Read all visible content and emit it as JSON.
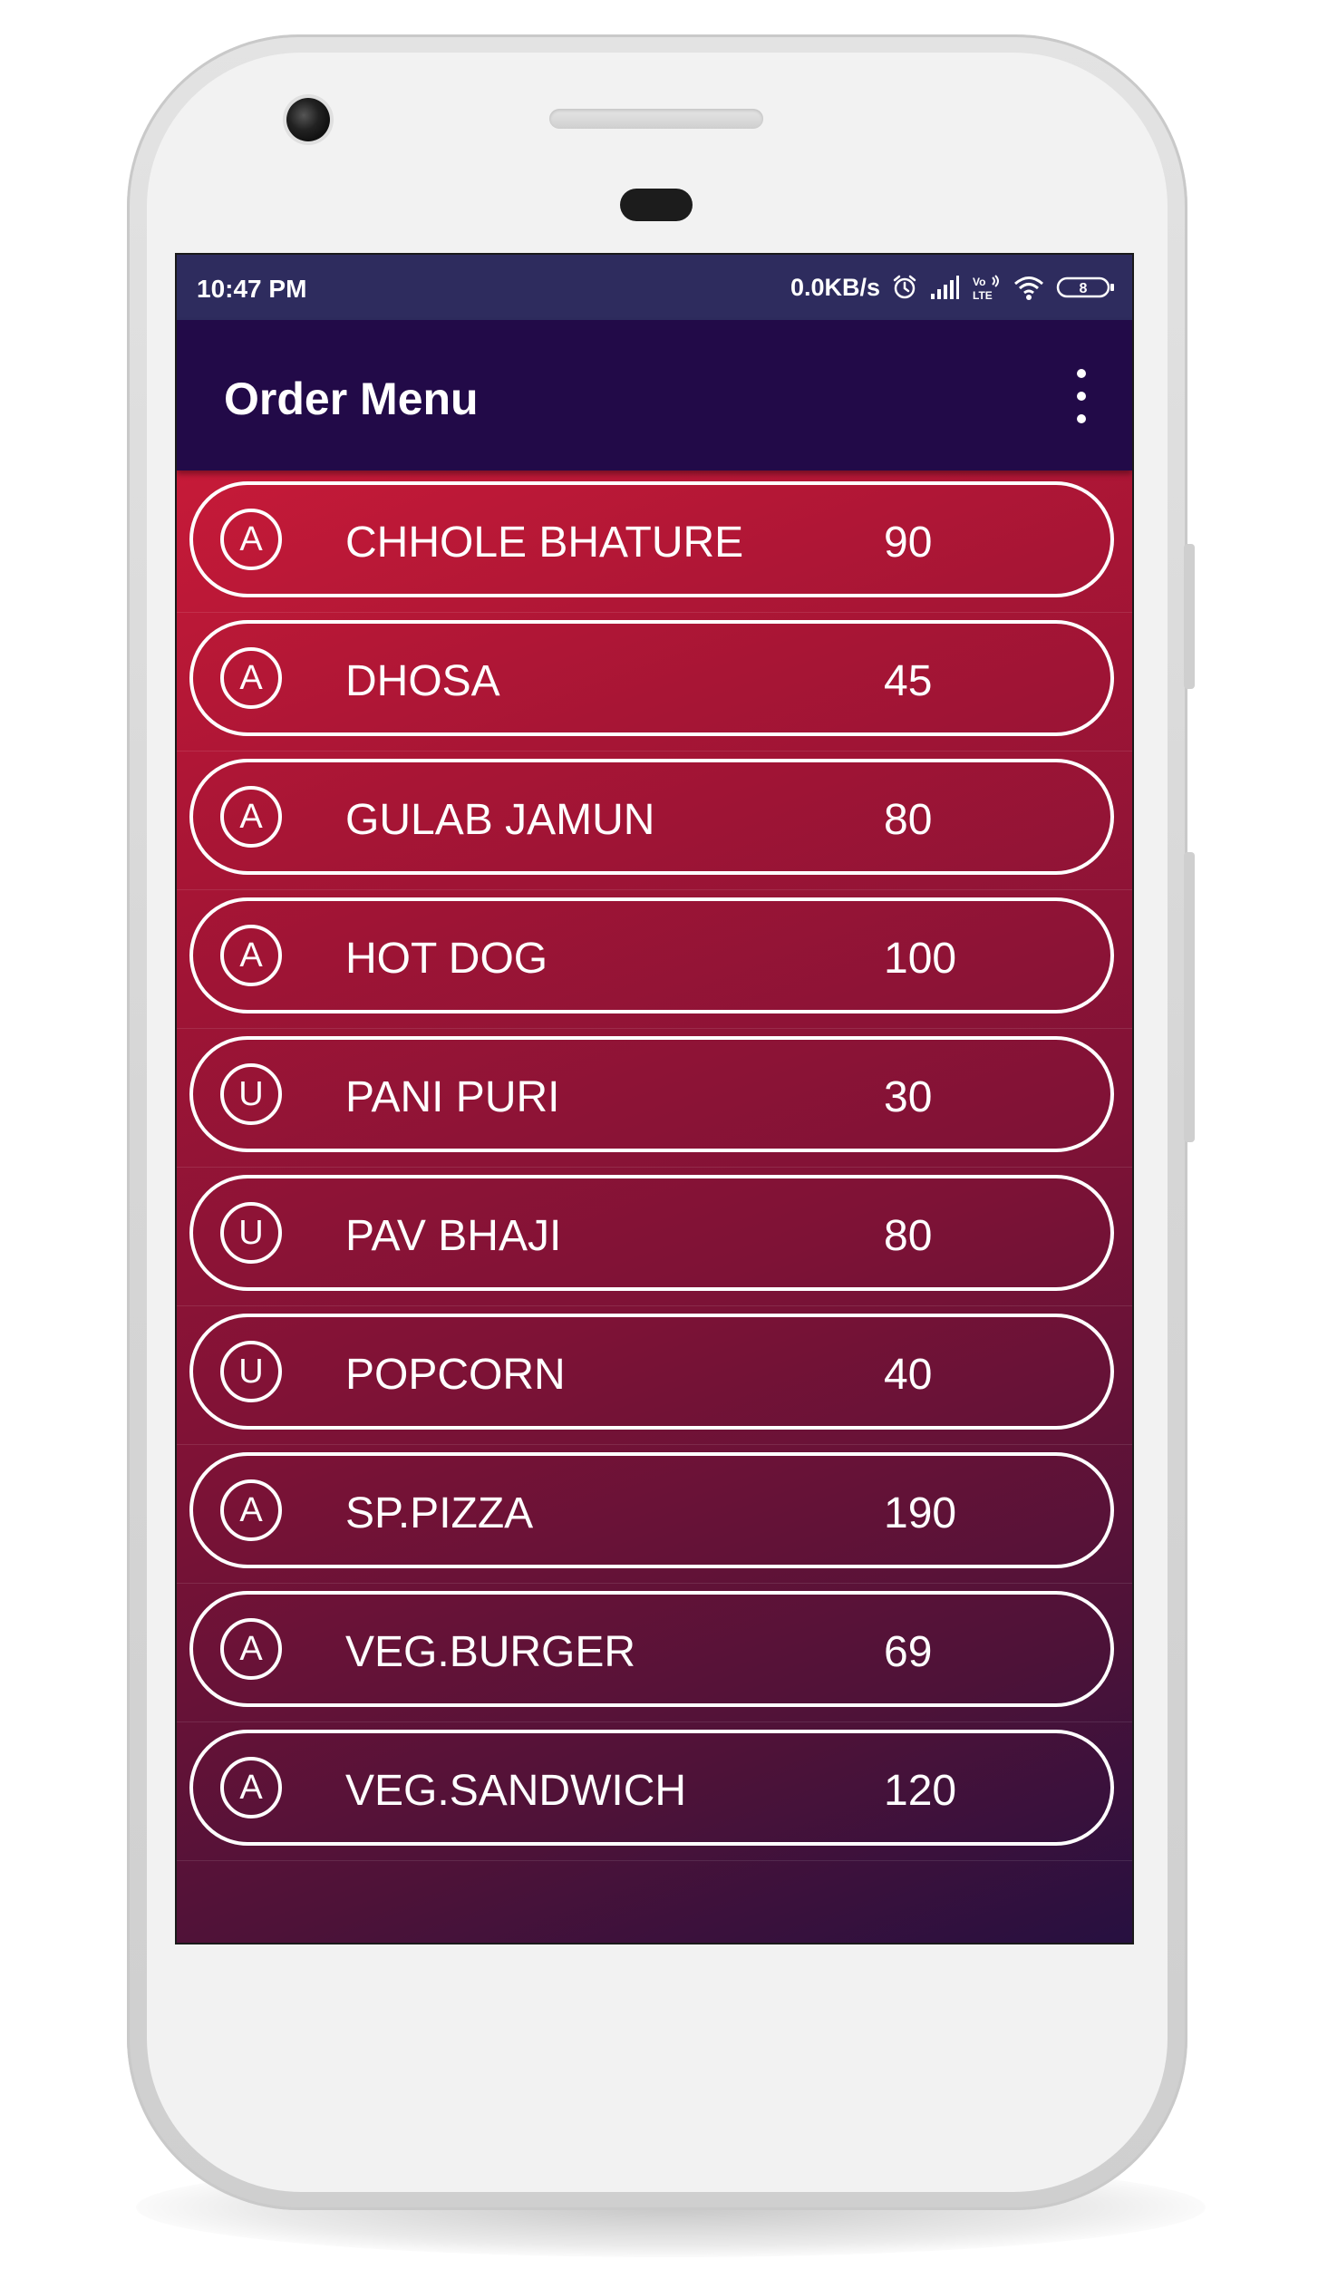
{
  "status_bar": {
    "time": "10:47 PM",
    "network_speed": "0.0KB/s",
    "icons": [
      "alarm-icon",
      "signal-icon",
      "volte-icon",
      "wifi-icon",
      "battery-icon"
    ],
    "battery_level": "8"
  },
  "app_bar": {
    "title": "Order Menu",
    "menu_icon": "more-vert-icon"
  },
  "menu": {
    "items": [
      {
        "badge": "A",
        "name": "CHHOLE BHATURE",
        "price": "90"
      },
      {
        "badge": "A",
        "name": "DHOSA",
        "price": "45"
      },
      {
        "badge": "A",
        "name": "GULAB JAMUN",
        "price": "80"
      },
      {
        "badge": "A",
        "name": "HOT DOG",
        "price": "100"
      },
      {
        "badge": "U",
        "name": "PANI PURI",
        "price": "30"
      },
      {
        "badge": "U",
        "name": "PAV BHAJI",
        "price": "80"
      },
      {
        "badge": "U",
        "name": "POPCORN",
        "price": "40"
      },
      {
        "badge": "A",
        "name": "SP.PIZZA",
        "price": "190"
      },
      {
        "badge": "A",
        "name": "VEG.BURGER",
        "price": "69"
      },
      {
        "badge": "A",
        "name": "VEG.SANDWICH",
        "price": "120"
      }
    ]
  },
  "colors": {
    "status_bar": "#2e2c5e",
    "app_bar": "#220a48",
    "gradient_start": "#c61a38",
    "gradient_end": "#261040",
    "card_border": "#ffffff"
  }
}
